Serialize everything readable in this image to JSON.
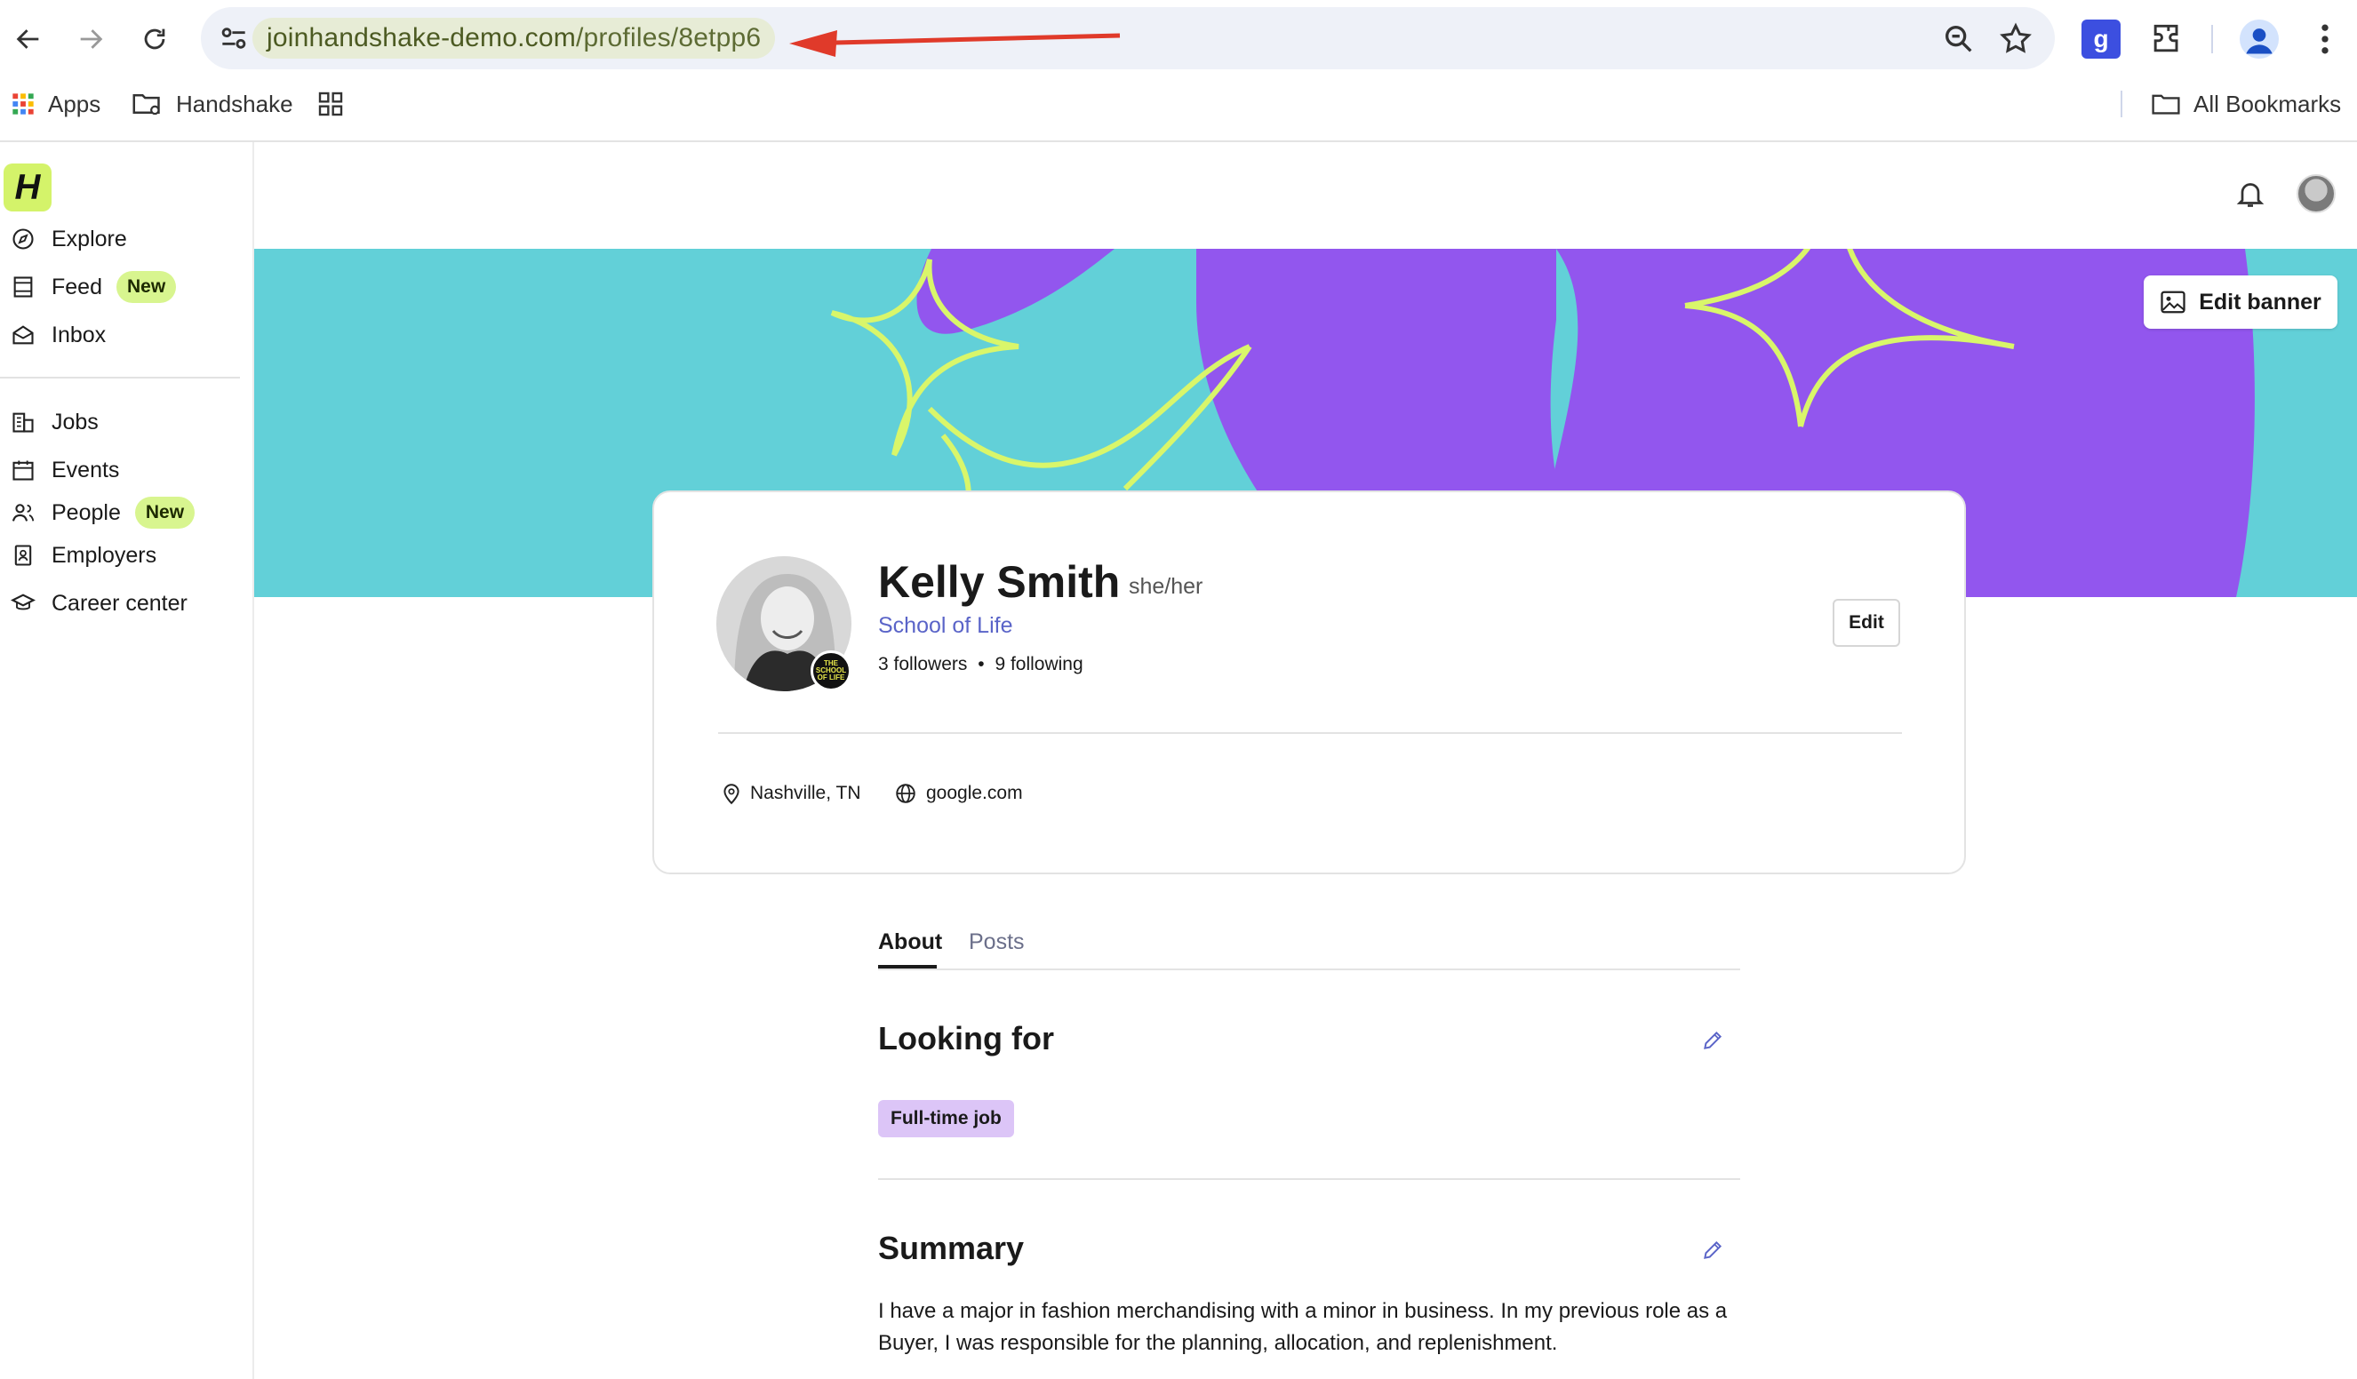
{
  "browser": {
    "url_host": "joinhandshake-demo.com",
    "url_path": "/profiles/8etpp6",
    "annotation_color": "#e03a2a"
  },
  "bookmarks": {
    "apps_label": "Apps",
    "handshake_label": "Handshake",
    "all_bookmarks_label": "All Bookmarks"
  },
  "sidebar": {
    "logo_letter": "H",
    "items": [
      {
        "label": "Explore",
        "icon": "compass-icon"
      },
      {
        "label": "Feed",
        "icon": "feed-icon",
        "badge": "New"
      },
      {
        "label": "Inbox",
        "icon": "inbox-icon"
      },
      {
        "label": "Jobs",
        "icon": "jobs-icon"
      },
      {
        "label": "Events",
        "icon": "calendar-icon"
      },
      {
        "label": "People",
        "icon": "people-icon",
        "badge": "New"
      },
      {
        "label": "Employers",
        "icon": "employers-icon"
      },
      {
        "label": "Career center",
        "icon": "graduation-cap-icon"
      }
    ]
  },
  "banner": {
    "edit_label": "Edit banner",
    "colors": {
      "background": "#62d0d8",
      "shape": "#9256ee",
      "stroke": "#d9f66a"
    }
  },
  "profile": {
    "name": "Kelly Smith",
    "pronouns": "she/her",
    "school": "School of Life",
    "followers": "3 followers",
    "separator": "•",
    "following": "9 following",
    "edit_label": "Edit",
    "location": "Nashville, TN",
    "website": "google.com",
    "school_badge_text": "THE SCHOOL OF LIFE"
  },
  "tabs": [
    {
      "label": "About",
      "active": true
    },
    {
      "label": "Posts",
      "active": false
    }
  ],
  "sections": {
    "looking_for": {
      "title": "Looking for",
      "chips": [
        "Full-time job"
      ]
    },
    "summary": {
      "title": "Summary",
      "text": "I have a major in fashion merchandising with a minor in business. In my previous role as a Buyer, I was responsible for the planning, allocation, and replenishment."
    }
  },
  "colors": {
    "accent_link": "#5a64c8",
    "new_badge": "#d8f58f",
    "chip": "#dcc5f7",
    "logo": "#d4f36a"
  }
}
